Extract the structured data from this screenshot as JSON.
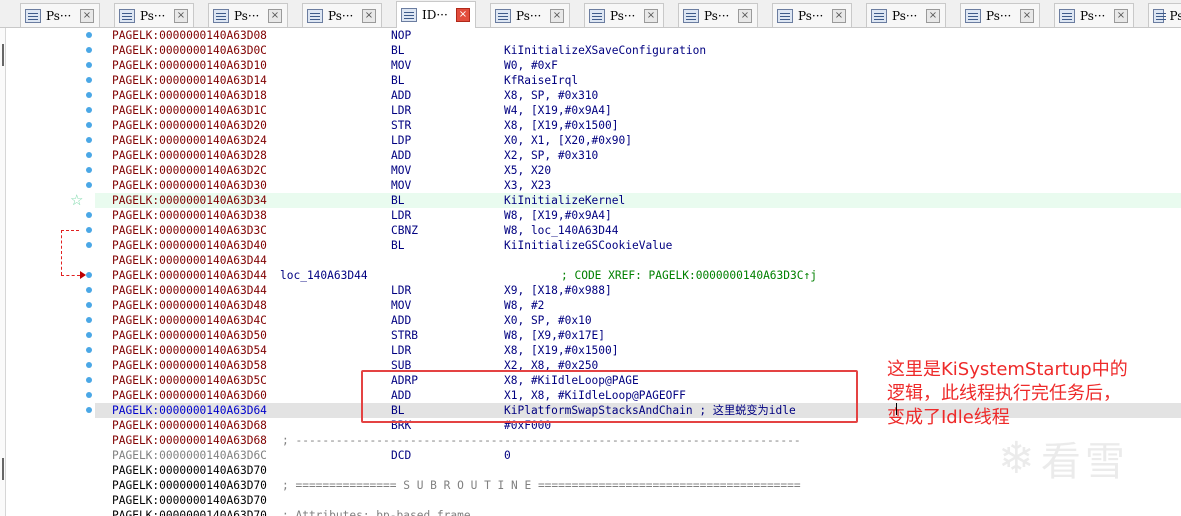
{
  "tabs": [
    {
      "label": "Ps···",
      "active": false
    },
    {
      "label": "Ps···",
      "active": false
    },
    {
      "label": "Ps···",
      "active": false
    },
    {
      "label": "Ps···",
      "active": false
    },
    {
      "label": "ID···",
      "active": true
    },
    {
      "label": "Ps···",
      "active": false
    },
    {
      "label": "Ps···",
      "active": false
    },
    {
      "label": "Ps···",
      "active": false
    },
    {
      "label": "Ps···",
      "active": false
    },
    {
      "label": "Ps···",
      "active": false
    },
    {
      "label": "Ps···",
      "active": false
    },
    {
      "label": "Ps···",
      "active": false
    },
    {
      "label": "Ps···",
      "active": false
    }
  ],
  "tab_close_glyph": "×",
  "listing": [
    {
      "addr": "PAGELK:0000000140A63D08",
      "mn": "NOP",
      "op": ""
    },
    {
      "addr": "PAGELK:0000000140A63D0C",
      "mn": "BL",
      "op": "KiInitializeXSaveConfiguration"
    },
    {
      "addr": "PAGELK:0000000140A63D10",
      "mn": "MOV",
      "op": "W0, #0xF"
    },
    {
      "addr": "PAGELK:0000000140A63D14",
      "mn": "BL",
      "op": "KfRaiseIrql"
    },
    {
      "addr": "PAGELK:0000000140A63D18",
      "mn": "ADD",
      "op": "X8, SP, #0x310"
    },
    {
      "addr": "PAGELK:0000000140A63D1C",
      "mn": "LDR",
      "op": "W4, [X19,#0x9A4]"
    },
    {
      "addr": "PAGELK:0000000140A63D20",
      "mn": "STR",
      "op": "X8, [X19,#0x1500]"
    },
    {
      "addr": "PAGELK:0000000140A63D24",
      "mn": "LDP",
      "op": "X0, X1, [X20,#0x90]"
    },
    {
      "addr": "PAGELK:0000000140A63D28",
      "mn": "ADD",
      "op": "X2, SP, #0x310"
    },
    {
      "addr": "PAGELK:0000000140A63D2C",
      "mn": "MOV",
      "op": "X5, X20"
    },
    {
      "addr": "PAGELK:0000000140A63D30",
      "mn": "MOV",
      "op": "X3, X23"
    },
    {
      "addr": "PAGELK:0000000140A63D34",
      "mn": "BL",
      "op": "KiInitializeKernel"
    },
    {
      "addr": "PAGELK:0000000140A63D38",
      "mn": "LDR",
      "op": "W8, [X19,#0x9A4]"
    },
    {
      "addr": "PAGELK:0000000140A63D3C",
      "mn": "CBNZ",
      "op": "W8, loc_140A63D44"
    },
    {
      "addr": "PAGELK:0000000140A63D40",
      "mn": "BL",
      "op": "KiInitializeGSCookieValue"
    },
    {
      "addr": "PAGELK:0000000140A63D44",
      "mn": "",
      "op": ""
    },
    {
      "addr": "PAGELK:0000000140A63D44",
      "label": "loc_140A63D44",
      "comment": "; CODE XREF: PAGELK:0000000140A63D3C↑j"
    },
    {
      "addr": "PAGELK:0000000140A63D44",
      "mn": "LDR",
      "op": "X9, [X18,#0x988]"
    },
    {
      "addr": "PAGELK:0000000140A63D48",
      "mn": "MOV",
      "op": "W8, #2"
    },
    {
      "addr": "PAGELK:0000000140A63D4C",
      "mn": "ADD",
      "op": "X0, SP, #0x10"
    },
    {
      "addr": "PAGELK:0000000140A63D50",
      "mn": "STRB",
      "op": "W8, [X9,#0x17E]"
    },
    {
      "addr": "PAGELK:0000000140A63D54",
      "mn": "LDR",
      "op": "X8, [X19,#0x1500]"
    },
    {
      "addr": "PAGELK:0000000140A63D58",
      "mn": "SUB",
      "op": "X2, X8, #0x250"
    },
    {
      "addr": "PAGELK:0000000140A63D5C",
      "mn": "ADRP",
      "op": "X8, #KiIdleLoop@PAGE"
    },
    {
      "addr": "PAGELK:0000000140A63D60",
      "mn": "ADD",
      "op": "X1, X8, #KiIdleLoop@PAGEOFF"
    },
    {
      "addr": "PAGELK:0000000140A63D64",
      "mn": "BL",
      "op": "KiPlatformSwapStacksAndChain ; 这里蜕变为idle"
    },
    {
      "addr": "PAGELK:0000000140A63D68",
      "mn": "BRK",
      "op": "#0xF000"
    },
    {
      "addr": "PAGELK:0000000140A63D68",
      "sep": "; ---------------------------------------------------------------------------"
    },
    {
      "addr": "PAGELK:0000000140A63D6C",
      "mn": "DCD",
      "op": "0"
    },
    {
      "addr": "PAGELK:0000000140A63D70",
      "mn": "",
      "op": ""
    },
    {
      "addr": "PAGELK:0000000140A63D70",
      "sep": "; =============== S U B R O U T I N E ======================================="
    },
    {
      "addr": "PAGELK:0000000140A63D70",
      "mn": "",
      "op": ""
    },
    {
      "addr": "PAGELK:0000000140A63D70",
      "sep": "; Attributes: bp-based frame"
    }
  ],
  "annotation": {
    "line1": "这里是KiSystemStartup中的",
    "line2": "逻辑，此线程执行完任务后，",
    "line3": "变成了Idle线程",
    "color": "#ee2a2a"
  },
  "watermark": {
    "text": "看雪",
    "icon": "snowflake-icon"
  },
  "colors": {
    "address": "#800000",
    "current_address": "#0000c8",
    "code": "#000080",
    "comment": "#008000",
    "highlight_green": "#e9fbef",
    "highlight_current": "#e3e3e3",
    "breakpoint_dot": "#4aa7e6",
    "jump_arrow": "#e02020"
  }
}
